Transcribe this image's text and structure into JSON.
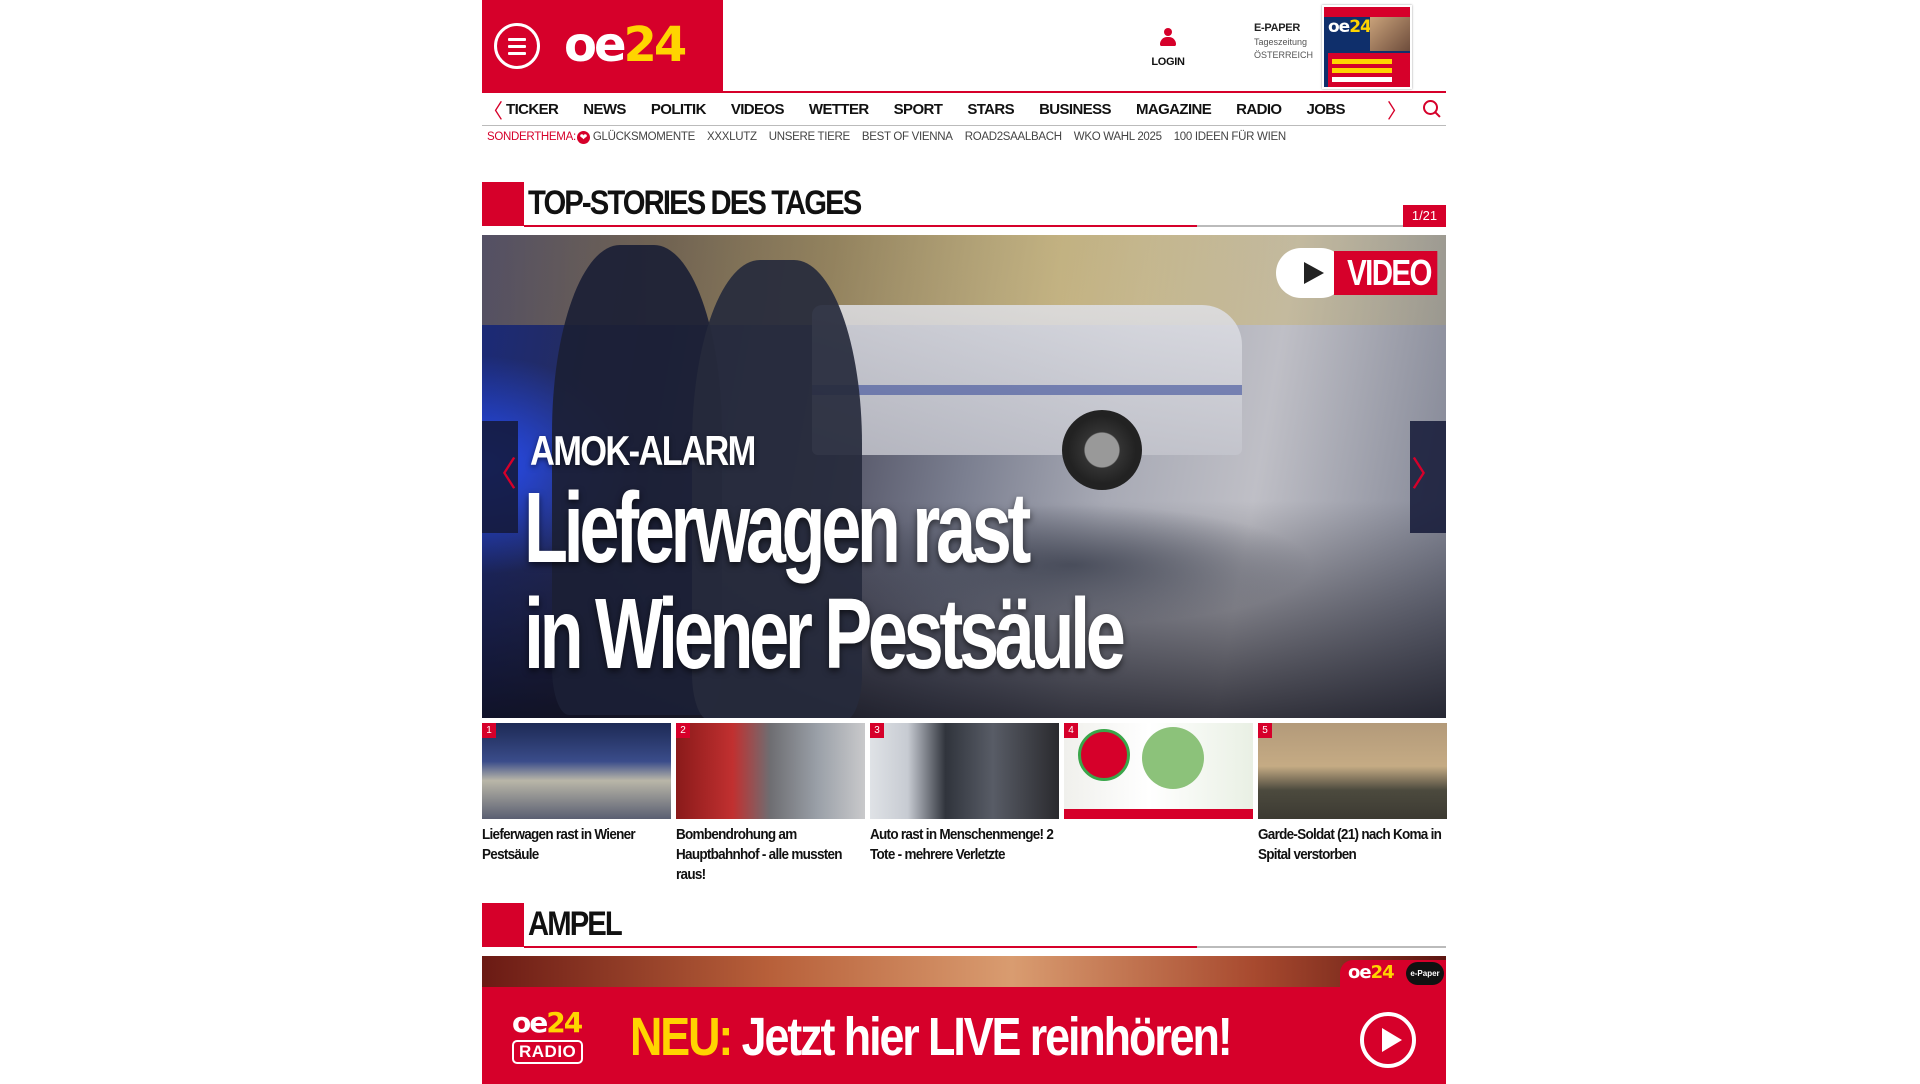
{
  "header": {
    "logo": {
      "prefix": "oe",
      "suffix": "24"
    },
    "login_label": "LOGIN",
    "epaper": {
      "title": "E-PAPER",
      "line1": "Tageszeitung",
      "line2": "ÖSTERREICH"
    }
  },
  "nav": {
    "items": [
      "TICKER",
      "NEWS",
      "POLITIK",
      "VIDEOS",
      "WETTER",
      "SPORT",
      "STARS",
      "BUSINESS",
      "MAGAZINE",
      "RADIO",
      "JOBS"
    ],
    "prev_glyph": "〈",
    "next_glyph": "〉"
  },
  "subnav": {
    "label": "SONDERTHEMA:",
    "items": [
      "GLÜCKSMOMENTE",
      "XXXLUTZ",
      "UNSERE TIERE",
      "BEST OF VIENNA",
      "ROAD2SAALBACH",
      "WKO WAHL 2025",
      "100 IDEEN FÜR WIEN"
    ]
  },
  "top_stories": {
    "title": "TOP-STORIES DES TAGES",
    "counter": "1/21",
    "hero": {
      "badge": "VIDEO",
      "kicker": "AMOK-ALARM",
      "headline_line1": "Lieferwagen rast",
      "headline_line2": "in Wiener Pestsäule"
    },
    "thumbs": [
      {
        "num": "1",
        "caption": "Lieferwagen rast in Wiener Pestsäule"
      },
      {
        "num": "2",
        "caption": "Bombendrohung am Hauptbahnhof - alle mussten raus!"
      },
      {
        "num": "3",
        "caption": "Auto rast in Menschenmenge! 2 Tote - mehrere Verletzte"
      },
      {
        "num": "4",
        "caption": ""
      },
      {
        "num": "5",
        "caption": "Garde-Soldat (21) nach Koma in Spital verstorben"
      }
    ]
  },
  "ampel": {
    "title": "AMPEL",
    "banner": {
      "radio_logo_prefix": "oe",
      "radio_logo_suffix": "24",
      "radio_word": "RADIO",
      "neu": "NEU:",
      "text": "Jetzt hier LIVE reinhören!",
      "epaper_tag": "e-Paper"
    }
  },
  "colors": {
    "brand_red": "#d6002a",
    "brand_yellow": "#ffd400"
  }
}
